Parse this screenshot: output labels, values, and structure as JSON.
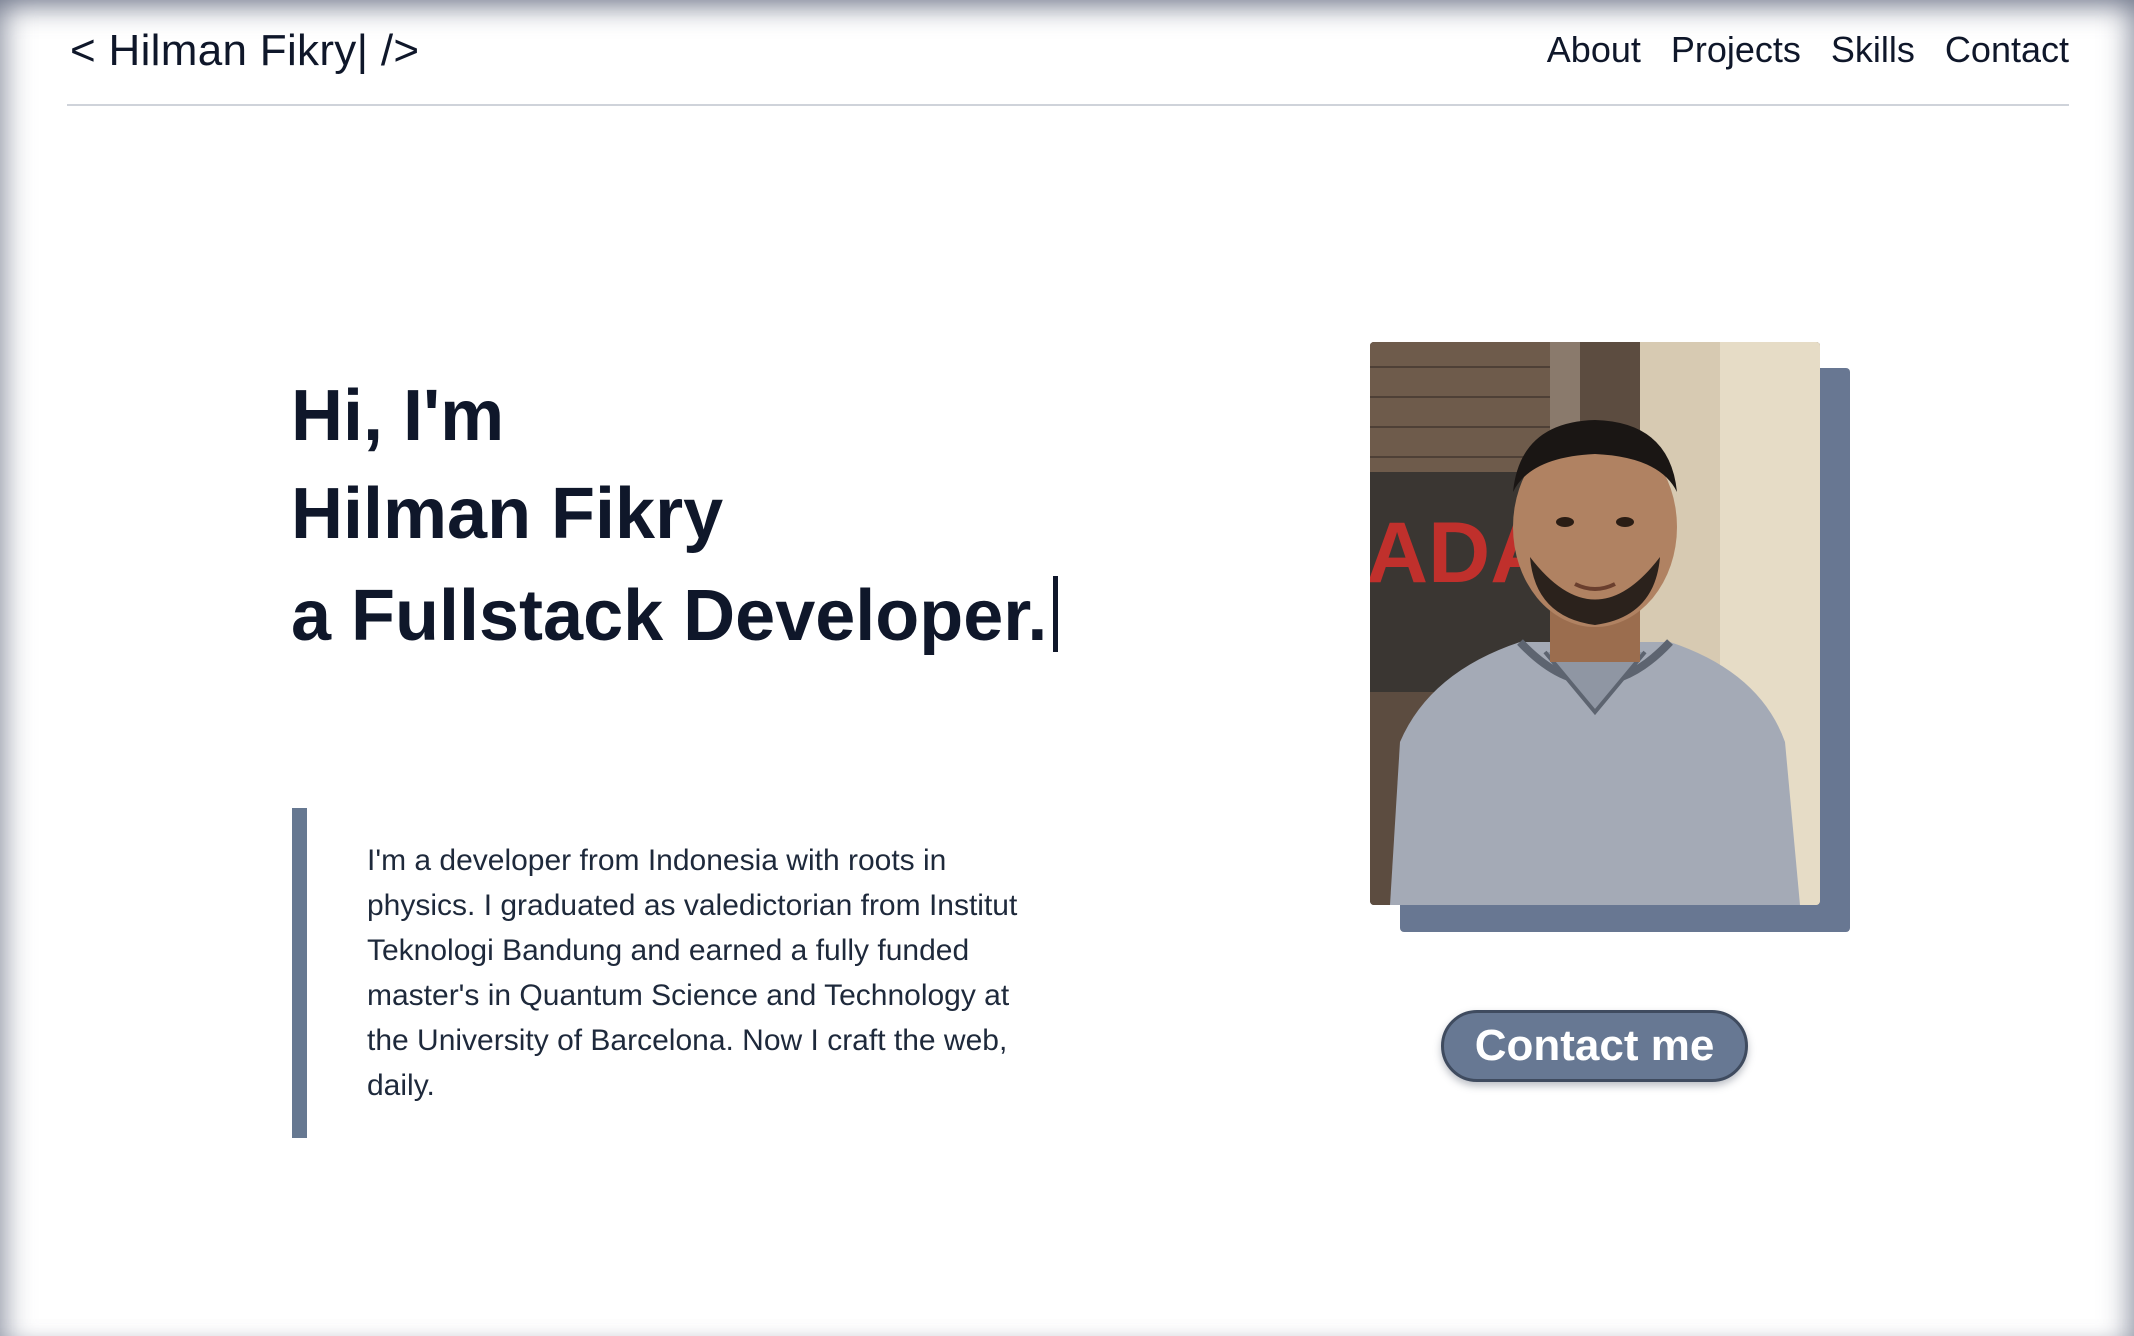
{
  "header": {
    "logo": "< Hilman Fikry| />",
    "nav": [
      "About",
      "Projects",
      "Skills",
      "Contact"
    ]
  },
  "hero": {
    "greeting": "Hi, I'm",
    "name": "Hilman Fikry",
    "role": "a Fullstack Developer."
  },
  "about": {
    "text": "I'm a developer from Indonesia with roots in physics. I graduated as valedictorian from Institut Teknologi Bandung and earned a fully funded master's in Quantum Science and Technology at the University of Barcelona. Now I craft the web, daily."
  },
  "cta": {
    "label": "Contact me"
  },
  "colors": {
    "accent": "#677893",
    "text": "#0f172a",
    "background": "#ffffff"
  }
}
